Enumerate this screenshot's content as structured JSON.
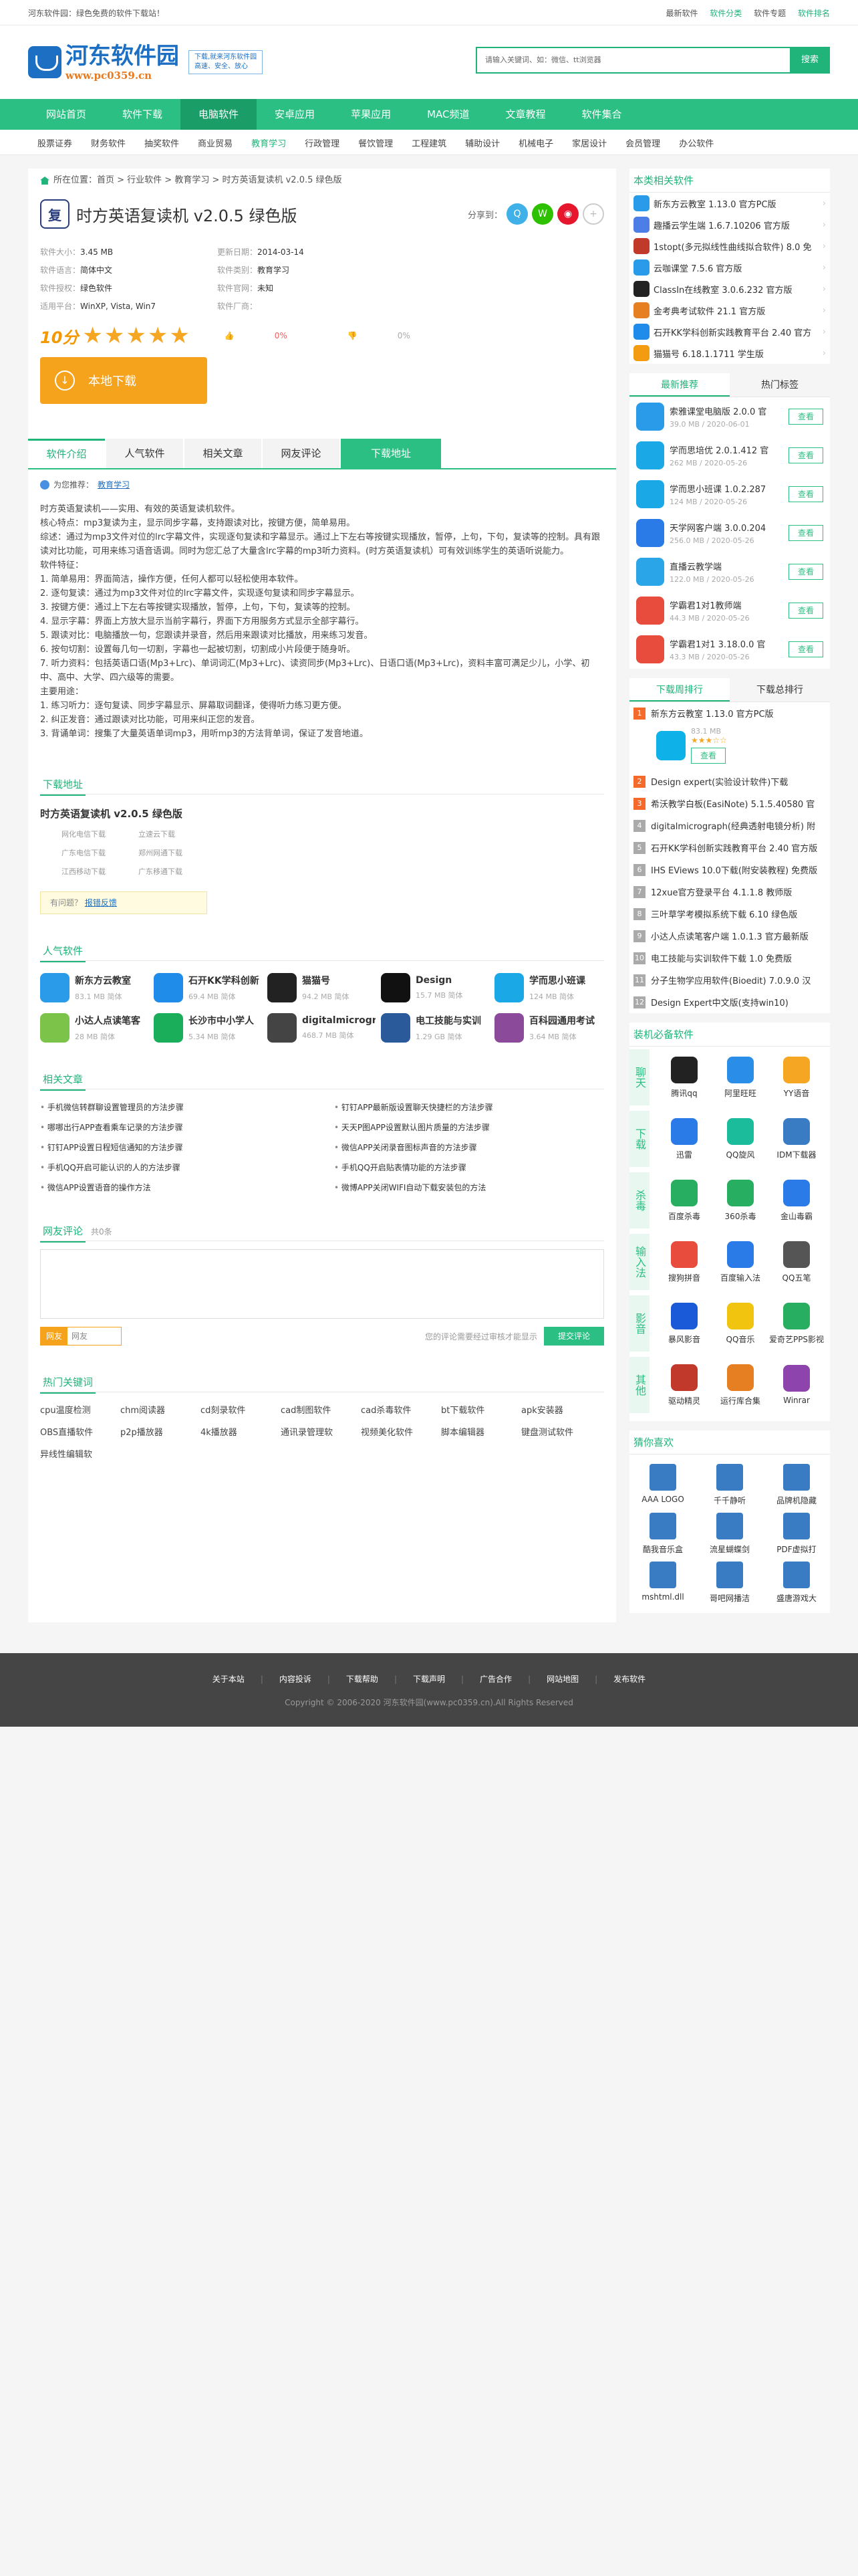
{
  "top": {
    "welcome": "河东软件园：绿色免费的软件下载站！",
    "links": [
      "最新软件",
      "软件分类",
      "软件专题",
      "软件排名"
    ]
  },
  "header": {
    "logo_title": "河东软件园",
    "logo_url": "www.pc0359.cn",
    "slogan1": "下载,就来河东软件园",
    "slogan2": "高速、安全、放心",
    "search_placeholder": "请输入关键词、如：微信、tt浏览器",
    "search_btn": "搜索"
  },
  "nav": [
    "网站首页",
    "软件下载",
    "电脑软件",
    "安卓应用",
    "苹果应用",
    "MAC频道",
    "文章教程",
    "软件集合"
  ],
  "subnav": [
    "股票证券",
    "财务软件",
    "抽奖软件",
    "商业贸易",
    "教育学习",
    "行政管理",
    "餐饮管理",
    "工程建筑",
    "辅助设计",
    "机械电子",
    "家居设计",
    "会员管理",
    "办公软件"
  ],
  "crumb": "所在位置：首页 > 行业软件 > 教育学习 > 时方英语复读机 v2.0.5 绿色版",
  "app": {
    "icon_letter": "复",
    "title": "时方英语复读机 v2.0.5 绿色版",
    "share_label": "分享到："
  },
  "info": [
    {
      "k": "软件大小：",
      "v": "3.45 MB"
    },
    {
      "k": "更新日期：",
      "v": "2014-03-14"
    },
    {
      "k": "软件语言：",
      "v": "简体中文"
    },
    {
      "k": "软件类别：",
      "v": "教育学习"
    },
    {
      "k": "软件授权：",
      "v": "绿色软件"
    },
    {
      "k": "软件官网：",
      "v": "未知"
    },
    {
      "k": "适用平台：",
      "v": "WinXP, Vista, Win7"
    },
    {
      "k": "软件厂商：",
      "v": ""
    }
  ],
  "rating": {
    "score": "10分",
    "stars": "★★★★★",
    "up": "0%",
    "down": "0%"
  },
  "download_btn": "本地下载",
  "tabs": [
    "软件介绍",
    "人气软件",
    "相关文章",
    "网友评论",
    "下载地址"
  ],
  "recom": {
    "label": "为您推荐：",
    "link": "教育学习"
  },
  "desc": [
    "时方英语复读机——实用、有效的英语复读机软件。",
    "核心特点：mp3复读为主，显示同步字幕，支持跟读对比，按键方便，简单易用。",
    "综述：通过为mp3文件对位的lrc字幕文件，实现逐句复读和字幕显示。通过上下左右等按键实现播放，暂停，上句，下句，复读等的控制。具有跟读对比功能，可用来练习语音语调。同时为您汇总了大量含lrc字幕的mp3听力资料。(时方英语复读机）可有效训练学生的英语听说能力。",
    "软件特征：",
    "1. 简单易用：界面简洁，操作方便，任何人都可以轻松使用本软件。",
    "2. 逐句复读：通过为mp3文件对位的lrc字幕文件，实现逐句复读和同步字幕显示。",
    "3. 按键方便：通过上下左右等按键实现播放，暂停，上句，下句，复读等的控制。",
    "4. 显示字幕：界面上方放大显示当前字幕行，界面下方用服务方式显示全部字幕行。",
    "5. 跟读对比：电脑播放一句，您跟读并录音，然后用来跟读对比播放，用来练习发音。",
    "6. 按句切割：设置每几句一切割，字幕也一起被切割，切割成小片段便于随身听。",
    "7. 听力资料：包括英语口语(Mp3+Lrc)、单词词汇(Mp3+Lrc)、读资同步(Mp3+Lrc)、日语口语(Mp3+Lrc)，资料丰富可满足少儿，小学、初中、高中、大学、四六级等的需要。",
    "主要用途：",
    "1. 练习听力：逐句复读、同步字幕显示、屏幕取词翻译，使得听力练习更方便。",
    "2. 纠正发音：通过跟读对比功能，可用来纠正您的发音。",
    "3. 背诵单词：搜集了大量英语单词mp3，用听mp3的方法背单词，保证了发音地道。"
  ],
  "dl": {
    "section": "下载地址",
    "title": "时方英语复读机 v2.0.5 绿色版",
    "mirrors": [
      [
        "网化电信下载",
        "立速云下载"
      ],
      [
        "广东电信下载",
        "郑州网通下载"
      ],
      [
        "江西移动下载",
        "广东移通下载"
      ]
    ],
    "ques": "有问题？",
    "report": "报错反馈"
  },
  "hot": {
    "section": "人气软件",
    "items": [
      {
        "n": "新东方云教室",
        "s": "83.1 MB 简体",
        "c": "#2a9be8"
      },
      {
        "n": "石开KK学科创新",
        "s": "69.4 MB 简体",
        "c": "#1e8ce8"
      },
      {
        "n": "猫猫号",
        "s": "94.2 MB 简体",
        "c": "#222"
      },
      {
        "n": "Design",
        "s": "15.7 MB 简体",
        "c": "#111"
      },
      {
        "n": "学而思小班课",
        "s": "124 MB 简体",
        "c": "#1aa8e6"
      },
      {
        "n": "小达人点读笔客",
        "s": "28 MB 简体",
        "c": "#7cc34a"
      },
      {
        "n": "长沙市中小学人",
        "s": "5.34 MB 简体",
        "c": "#1aad5a"
      },
      {
        "n": "digitalmicrogr",
        "s": "468.7 MB 简体",
        "c": "#444"
      },
      {
        "n": "电工技能与实训",
        "s": "1.29 GB 简体",
        "c": "#2a5a9a"
      },
      {
        "n": "百科园通用考试",
        "s": "3.64 MB 简体",
        "c": "#8b4a9a"
      }
    ]
  },
  "arts": {
    "section": "相关文章",
    "items": [
      "手机微信转群聊设置管理员的方法步骤",
      "钉钉APP最新版设置聊天快捷栏的方法步骤",
      "哪哪出行APP查看乘车记录的方法步骤",
      "天天P图APP设置默认图片质量的方法步骤",
      "钉钉APP设置日程短信通知的方法步骤",
      "微信APP关闭录音图标声音的方法步骤",
      "手机QQ开启可能认识的人的方法步骤",
      "手机QQ开启贴表情功能的方法步骤",
      "微信APP设置语音的操作方法",
      "微博APP关闭WIFI自动下载安装包的方法"
    ]
  },
  "cmt": {
    "section": "网友评论",
    "count": "共0条",
    "nick_l": "网友",
    "nick_r": "网友",
    "tip": "您的评论需要经过审核才能显示",
    "btn": "提交评论"
  },
  "kw": {
    "section": "热门关键词",
    "items": [
      "cpu温度检测",
      "chm阅读器",
      "cd刻录软件",
      "cad制图软件",
      "cad杀毒软件",
      "bt下载软件",
      "apk安装器",
      "OBS直播软件",
      "p2p播放器",
      "4k播放器",
      "通讯录管理软",
      "视频美化软件",
      "脚本编辑器",
      "键盘测试软件",
      "异线性编辑软"
    ]
  },
  "side": {
    "related": {
      "title": "本类相关软件",
      "items": [
        {
          "n": "新东方云教室 1.13.0 官方PC版",
          "c": "#2a9be8"
        },
        {
          "n": "趣播云学生端 1.6.7.10206 官方版",
          "c": "#4d7ee8"
        },
        {
          "n": "1stopt(多元拟线性曲线拟合软件) 8.0 免",
          "c": "#c0392b"
        },
        {
          "n": "云咖课堂 7.5.6 官方版",
          "c": "#2a9be8"
        },
        {
          "n": "ClassIn在线教室 3.0.6.232 官方版",
          "c": "#222"
        },
        {
          "n": "金考典考试软件 21.1 官方版",
          "c": "#e67e22"
        },
        {
          "n": "石开KK学科创新实践教育平台 2.40 官方",
          "c": "#1e8ce8"
        },
        {
          "n": "猫猫号 6.18.1.1711 学生版",
          "c": "#f39c12"
        }
      ]
    },
    "tabs1": [
      "最新推荐",
      "热门标签"
    ],
    "newrec": [
      {
        "n": "索雅课堂电脑版 2.0.0 官",
        "m": "39.0 MB / 2020-06-01",
        "c": "#2a9be8"
      },
      {
        "n": "学而思培优 2.0.1.412 官",
        "m": "262 MB / 2020-05-26",
        "c": "#1aa8e6"
      },
      {
        "n": "学而思小班课 1.0.2.287",
        "m": "124 MB / 2020-05-26",
        "c": "#1aa8e6"
      },
      {
        "n": "天学网客户端 3.0.0.204",
        "m": "256.0 MB / 2020-05-26",
        "c": "#2a7be8"
      },
      {
        "n": "直播云教学端",
        "m": "122.0 MB / 2020-05-26",
        "c": "#2aa5e8"
      },
      {
        "n": "学霸君1对1教师端",
        "m": "44.3 MB / 2020-05-26",
        "c": "#e74c3c"
      },
      {
        "n": "学霸君1对1 3.18.0.0 官",
        "m": "43.3 MB / 2020-05-26",
        "c": "#e74c3c"
      }
    ],
    "btn": "查看",
    "tabs2": [
      "下载周排行",
      "下载总排行"
    ],
    "rank1": {
      "n": "新东方云教室 1.13.0 官方PC版",
      "m": "83.1 MB",
      "stars": "★★★☆☆"
    },
    "rank": [
      "Design expert(实验设计软件)下载",
      "希沃教学白板(EasiNote) 5.1.5.40580 官",
      "digitalmicrograph(经典透射电镜分析) 附",
      "石开KK学科创新实践教育平台 2.40 官方版",
      "IHS EViews 10.0下载(附安装教程) 免费版",
      "12xue官方登录平台 4.1.1.8 教师版",
      "三叶草学考模拟系统下载 6.10 绿色版",
      "小达人点读笔客户端 1.0.1.3 官方最新版",
      "电工技能与实训软件下载 1.0 免费版",
      "分子生物学应用软件(Bioedit) 7.0.9.0 汉"
    ],
    "rank_nums": [
      "1",
      "2",
      "3",
      "4",
      "5",
      "6",
      "7",
      "8",
      "9",
      "10",
      "11",
      "12"
    ],
    "rank_last": "Design Expert中文版(支持win10)",
    "must": {
      "title": "装机必备软件",
      "rows": [
        {
          "cat": "聊天",
          "apps": [
            {
              "n": "腾讯qq",
              "c": "#222"
            },
            {
              "n": "阿里旺旺",
              "c": "#2a8ee8"
            },
            {
              "n": "YY语音",
              "c": "#f5a623"
            }
          ]
        },
        {
          "cat": "下载",
          "apps": [
            {
              "n": "迅雷",
              "c": "#2a7be8"
            },
            {
              "n": "QQ旋风",
              "c": "#1abc9c"
            },
            {
              "n": "IDM下载器",
              "c": "#3a7cc4"
            }
          ]
        },
        {
          "cat": "杀毒",
          "apps": [
            {
              "n": "百度杀毒",
              "c": "#27ae60"
            },
            {
              "n": "360杀毒",
              "c": "#27ae60"
            },
            {
              "n": "金山毒霸",
              "c": "#2a7be8"
            }
          ]
        },
        {
          "cat": "输入法",
          "apps": [
            {
              "n": "搜狗拼音",
              "c": "#e74c3c"
            },
            {
              "n": "百度输入法",
              "c": "#2a7be8"
            },
            {
              "n": "QQ五笔",
              "c": "#555"
            }
          ]
        },
        {
          "cat": "影音",
          "apps": [
            {
              "n": "暴风影音",
              "c": "#1a5ad8"
            },
            {
              "n": "QQ音乐",
              "c": "#f1c40f"
            },
            {
              "n": "爱奇艺PPS影视",
              "c": "#27ae60"
            }
          ]
        },
        {
          "cat": "其他",
          "apps": [
            {
              "n": "驱动精灵",
              "c": "#c0392b"
            },
            {
              "n": "运行库合集",
              "c": "#e67e22"
            },
            {
              "n": "Winrar",
              "c": "#8e44ad"
            }
          ]
        }
      ]
    },
    "guess": {
      "title": "猜你喜欢",
      "items": [
        "AAA LOGO",
        "千千静听",
        "品牌机隐藏",
        "酷我音乐盒",
        "流星蝴蝶剑",
        "PDF虚拟打",
        "mshtml.dll",
        "哥吧网播洁",
        "盛唐游戏大"
      ]
    }
  },
  "footer": {
    "links": [
      "关于本站",
      "内容投诉",
      "下载帮助",
      "下载声明",
      "广告合作",
      "网站地图",
      "发布软件"
    ],
    "copy": "Copyright © 2006-2020 河东软件园(www.pc0359.cn).All Rights Reserved"
  }
}
